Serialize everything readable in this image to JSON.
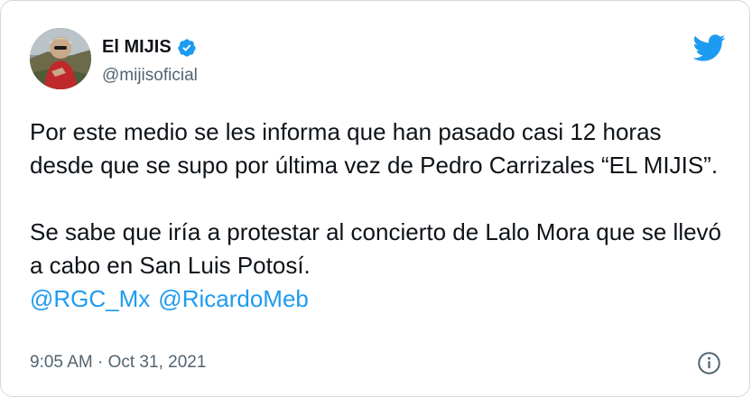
{
  "author": {
    "display_name": "El MIJIS",
    "handle": "@mijisoficial",
    "verified": true,
    "avatar_icon": "profile-photo"
  },
  "tweet": {
    "paragraph1": "Por este medio se les informa que han pasado casi 12 horas desde que se supo por última vez de Pedro Carrizales “EL MIJIS”.",
    "paragraph2": "Se sabe que iría a protestar al concierto de Lalo Mora que se llevó a cabo en San Luis Potosí.",
    "mentions": [
      "@RGC_Mx",
      "@RicardoMeb"
    ]
  },
  "meta": {
    "timestamp": "9:05 AM · Oct 31, 2021"
  },
  "icons": {
    "brand": "twitter-bird-icon",
    "verified": "verified-badge-icon",
    "info": "info-icon"
  },
  "colors": {
    "accent": "#1d9bf0",
    "text": "#0f1419",
    "secondary_text": "#536471",
    "border": "#cfd9de"
  }
}
